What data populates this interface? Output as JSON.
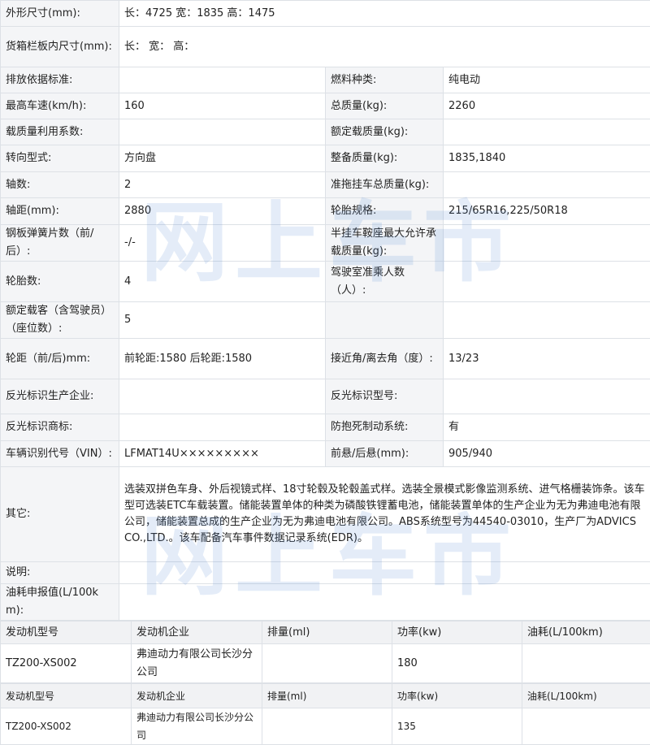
{
  "watermark": "网上车市",
  "spec": {
    "dims_label": "外形尺寸(mm):",
    "dims_value": "长：4725 宽：1835 高：1475",
    "cargo_label": "货箱栏板内尺寸(mm):",
    "cargo_value": "长：  宽：  高：",
    "rows": [
      {
        "l1": "排放依据标准:",
        "v1": "",
        "l2": "燃料种类:",
        "v2": "纯电动"
      },
      {
        "l1": "最高车速(km/h):",
        "v1": "160",
        "l2": "总质量(kg):",
        "v2": "2260"
      },
      {
        "l1": "载质量利用系数:",
        "v1": "",
        "l2": "额定载质量(kg):",
        "v2": ""
      },
      {
        "l1": "转向型式:",
        "v1": "方向盘",
        "l2": "整备质量(kg):",
        "v2": "1835,1840"
      },
      {
        "l1": "轴数:",
        "v1": "2",
        "l2": "准拖挂车总质量(kg):",
        "v2": ""
      },
      {
        "l1": "轴距(mm):",
        "v1": "2880",
        "l2": "轮胎规格:",
        "v2": "215/65R16,225/50R18"
      },
      {
        "l1": "钢板弹簧片数（前/后）:",
        "v1": "-/-",
        "l2": "半挂车鞍座最大允许承载质量(kg):",
        "v2": ""
      },
      {
        "l1": "轮胎数:",
        "v1": "4",
        "l2": "驾驶室准乘人数（人）:",
        "v2": ""
      },
      {
        "l1": "额定载客（含驾驶员）（座位数）:",
        "v1": "5",
        "l2": "",
        "v2": ""
      },
      {
        "l1": "轮距（前/后)mm:",
        "v1": "前轮距:1580 后轮距:1580",
        "l2": "接近角/离去角（度）:",
        "v2": "13/23"
      },
      {
        "l1": "反光标识生产企业:",
        "v1": "",
        "l2": "反光标识型号:",
        "v2": ""
      },
      {
        "l1": "反光标识商标:",
        "v1": "",
        "l2": "防抱死制动系统:",
        "v2": "有"
      },
      {
        "l1": "车辆识别代号（VIN）:",
        "v1": "LFMAT14U×××××××××",
        "l2": "前悬/后悬(mm):",
        "v2": "905/940"
      }
    ],
    "other_label": "其它:",
    "other_value": "选装双拼色车身、外后视镜式样、18寸轮毂及轮毂盖式样。选装全景模式影像监测系统、进气格栅装饰条。该车型可选装ETC车载装置。储能装置单体的种类为磷酸铁锂蓄电池，储能装置单体的生产企业为无为弗迪电池有限公司，储能装置总成的生产企业为无为弗迪电池有限公司。ABS系统型号为44540-03010，生产厂为ADVICS CO.,LTD.。该车配备汽车事件数据记录系统(EDR)。",
    "note_label": "说明:",
    "note_value": "",
    "fuel_label": "油耗申报值(L/100km):",
    "fuel_value": ""
  },
  "engine_tables": [
    {
      "headers": [
        "发动机型号",
        "发动机企业",
        "排量(ml)",
        "功率(kw)",
        "油耗(L/100km)"
      ],
      "row": [
        "TZ200-XS002",
        "弗迪动力有限公司长沙分公司",
        "",
        "180",
        ""
      ]
    },
    {
      "headers": [
        "发动机型号",
        "发动机企业",
        "排量(ml)",
        "功率(kw)",
        "油耗(L/100km)"
      ],
      "row": [
        "TZ200-XS002",
        "弗迪动力有限公司长沙分公司",
        "",
        "135",
        ""
      ]
    }
  ]
}
